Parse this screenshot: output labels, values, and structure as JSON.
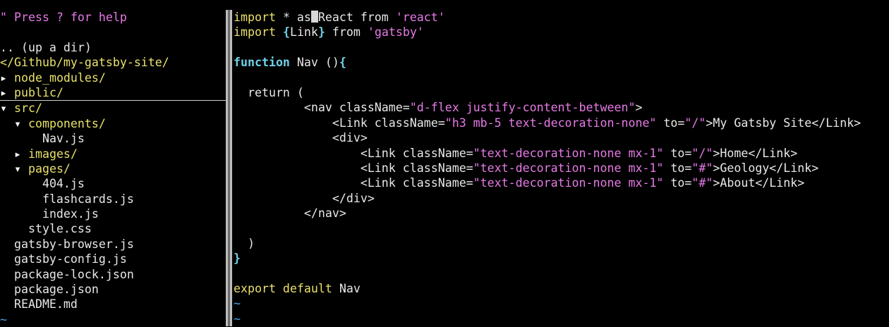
{
  "explorer": {
    "help": "\" Press ? for help",
    "up_dir": ".. (up a dir)",
    "root": "</Github/my-gatsby-site/",
    "node_modules": "node_modules/",
    "public": "public/",
    "src": "src/",
    "components": "components/",
    "nav_js": "Nav.js",
    "images": "images/",
    "pages": "pages/",
    "page_404": "404.js",
    "flashcards": "flashcards.js",
    "index": "index.js",
    "style_css": "style.css",
    "gatsby_browser": "gatsby-browser.js",
    "gatsby_config": "gatsby-config.js",
    "package_lock": "package-lock.json",
    "package_json": "package.json",
    "readme": "README.md",
    "collapsed_marker": "▸",
    "expanded_marker": "▾",
    "empty_marker": "~"
  },
  "editor": {
    "l1_import": "import",
    "l1_star": " * as",
    "l1_react": "React",
    "l1_from": " from ",
    "l1_str": "'react'",
    "l2_import": "import",
    "l2_open": "{",
    "l2_link": "Link",
    "l2_close": "}",
    "l2_from": " from ",
    "l2_str": "'gatsby'",
    "l4_function": "function",
    "l4_name": " Nav ()",
    "l4_brace": "{",
    "l6_return": "  return (",
    "l7_open": "          <nav className=",
    "l7_str": "\"d-flex justify-content-between\"",
    "l7_close": ">",
    "l8_open": "              <Link className=",
    "l8_str": "\"h3 mb-5 text-decoration-none\"",
    "l8_to": " to=",
    "l8_href": "\"/\"",
    "l8_text": ">My Gatsby Site</Link>",
    "l9_div": "              <div>",
    "l10_open": "                  <Link className=",
    "l10_str": "\"text-decoration-none mx-1\"",
    "l10_to": " to=",
    "l10_href": "\"/\"",
    "l10_text": ">Home</Link>",
    "l11_open": "                  <Link className=",
    "l11_str": "\"text-decoration-none mx-1\"",
    "l11_to": " to=",
    "l11_href": "\"#\"",
    "l11_text": ">Geology</Link>",
    "l12_open": "                  <Link className=",
    "l12_str": "\"text-decoration-none mx-1\"",
    "l12_to": " to=",
    "l12_href": "\"#\"",
    "l12_text": ">About</Link>",
    "l13_div": "              </div>",
    "l14_nav": "          </nav>",
    "l16_paren": "  )",
    "l17_brace": "}",
    "l19_export": "export default",
    "l19_name": " Nav",
    "empty_marker": "~"
  },
  "colors": {
    "background": "#000000",
    "directory": "#e9e26a",
    "keyword": "#ebe06b",
    "function_keyword": "#6fd1e8",
    "string": "#e67ae6",
    "help_comment": "#e67ae6",
    "tilde": "#4fa3e8",
    "text": "#e8e8e8",
    "split_bar": "#bdbdbd"
  }
}
